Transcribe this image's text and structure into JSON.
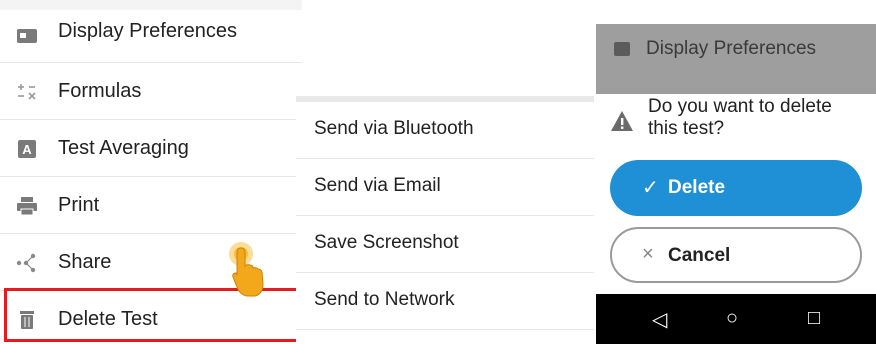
{
  "menu": {
    "items": [
      {
        "label": "Display Preferences",
        "icon": "display-icon"
      },
      {
        "label": "Formulas",
        "icon": "formulas-icon"
      },
      {
        "label": "Test Averaging",
        "icon": "test-averaging-icon"
      },
      {
        "label": "Print",
        "icon": "printer-icon"
      },
      {
        "label": "Share",
        "icon": "share-icon"
      },
      {
        "label": "Delete Test",
        "icon": "trash-icon"
      }
    ]
  },
  "share_sheet": {
    "items": [
      {
        "label": "Send via Bluetooth"
      },
      {
        "label": "Send via Email"
      },
      {
        "label": "Save Screenshot"
      },
      {
        "label": "Send to Network"
      }
    ]
  },
  "dialog": {
    "background_item": "Display Preferences",
    "message": "Do you want to delete this test?",
    "confirm_label": "Delete",
    "cancel_label": "Cancel"
  },
  "colors": {
    "highlight": "#e8191f",
    "primary": "#1f8fd6"
  }
}
